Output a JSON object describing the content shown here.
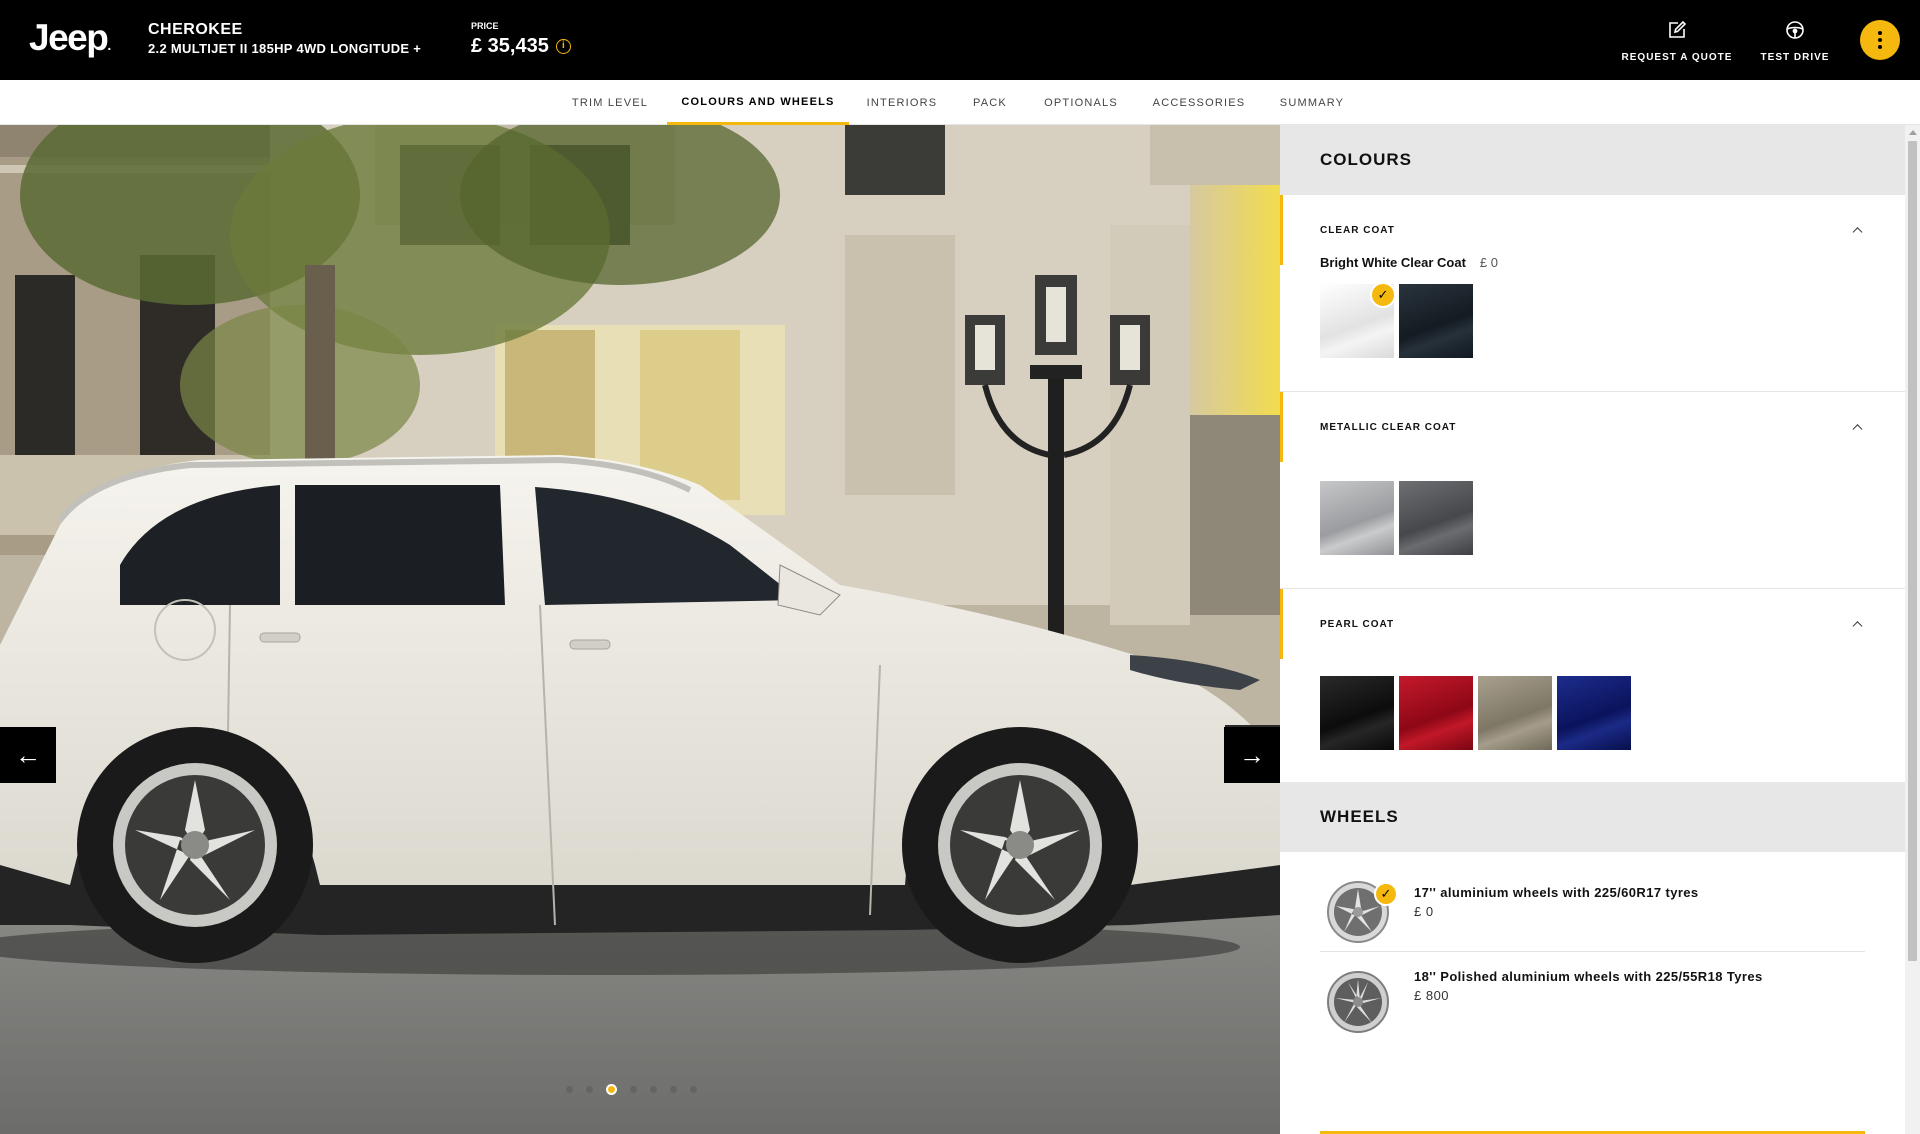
{
  "brand": {
    "logo_text": "Jeep"
  },
  "vehicle": {
    "name": "CHEROKEE",
    "version": "2.2 MULTIJET II 185HP 4WD LONGITUDE +"
  },
  "price": {
    "label": "PRICE",
    "value": "£ 35,435",
    "info_icon": "info-icon"
  },
  "header_actions": [
    {
      "label": "REQUEST A QUOTE",
      "icon": "edit-icon"
    },
    {
      "label": "TEST DRIVE",
      "icon": "steering-wheel-icon"
    }
  ],
  "menu_icon": "kebab-menu-icon",
  "tabs": [
    {
      "label": "TRIM LEVEL",
      "active": false
    },
    {
      "label": "COLOURS AND WHEELS",
      "active": true
    },
    {
      "label": "INTERIORS",
      "active": false
    },
    {
      "label": "PACK",
      "active": false
    },
    {
      "label": "OPTIONALS",
      "active": false
    },
    {
      "label": "ACCESSORIES",
      "active": false
    },
    {
      "label": "SUMMARY",
      "active": false
    }
  ],
  "gallery": {
    "slide_count": 7,
    "active_slide": 3,
    "prev_icon": "arrow-left-icon",
    "next_icon": "arrow-right-icon"
  },
  "colours": {
    "title": "COLOURS",
    "groups": [
      {
        "name": "CLEAR COAT",
        "selected_name": "Bright White Clear Coat",
        "selected_price": "£ 0",
        "swatches": [
          {
            "color": "#e9e9e9",
            "selected": true
          },
          {
            "color": "#1a222a",
            "selected": false
          }
        ]
      },
      {
        "name": "METALLIC CLEAR COAT",
        "swatches": [
          {
            "color": "#a9abad",
            "selected": false
          },
          {
            "color": "#56585b",
            "selected": false
          }
        ]
      },
      {
        "name": "PEARL COAT",
        "swatches": [
          {
            "color": "#141414",
            "selected": false
          },
          {
            "color": "#a3081c",
            "selected": false
          },
          {
            "color": "#8e8674",
            "selected": false
          },
          {
            "color": "#0d1a6b",
            "selected": false
          }
        ]
      }
    ]
  },
  "wheels": {
    "title": "WHEELS",
    "items": [
      {
        "name": "17'' aluminium wheels with 225/60R17 tyres",
        "price": "£ 0",
        "selected": true
      },
      {
        "name": "18'' Polished aluminium wheels with 225/55R18 Tyres",
        "price": "£ 800",
        "selected": false
      }
    ]
  },
  "colors": {
    "accent": "#f5b80e",
    "header_bg": "#000000",
    "section_bg": "#e7e7e7"
  }
}
